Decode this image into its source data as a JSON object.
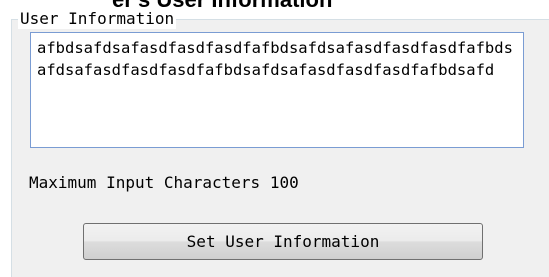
{
  "header": {
    "title": "er's User Information"
  },
  "group": {
    "legend": "User Information"
  },
  "input": {
    "value": "afbdsafdsafasdfasdfasdfafbdsafdsafasdfasdfasdfafbdsafdsafasdfasdfasdfafbdsafdsafasdfasdfasdfafbdsafd"
  },
  "info": {
    "max_label": "Maximum Input Characters 100"
  },
  "actions": {
    "set_label": "Set User Information"
  }
}
